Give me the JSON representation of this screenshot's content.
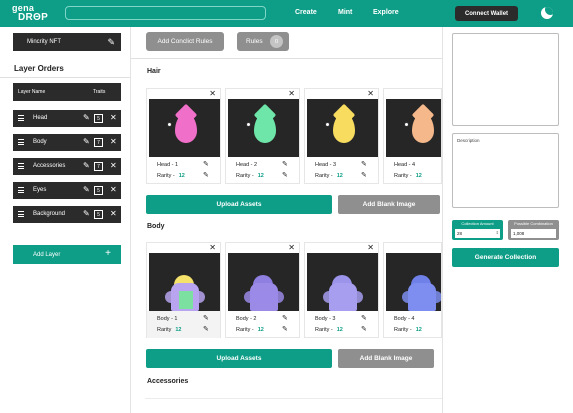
{
  "header": {
    "logo_line1": "gena",
    "logo_line2": "DRΘP",
    "nav": [
      "Create",
      "Mint",
      "Explore"
    ],
    "connect_wallet": "Connect Wallet"
  },
  "sidebar": {
    "collection_name": "Mincrity NFT",
    "layer_orders_title": "Layer Orders",
    "col_layer_name": "Layer Name",
    "col_traits": "Traits",
    "layers": [
      {
        "name": "Head",
        "traits": "5"
      },
      {
        "name": "Body",
        "traits": "7"
      },
      {
        "name": "Accessories",
        "traits": "7"
      },
      {
        "name": "Eyes",
        "traits": "5"
      },
      {
        "name": "Background",
        "traits": "5"
      }
    ],
    "add_layer": "Add Layer"
  },
  "main": {
    "add_rules": "Add Conclict Rules",
    "rules_label": "Rules",
    "rules_count": "0",
    "sections": [
      {
        "title": "Hair",
        "cards": [
          {
            "name": "Head - 1",
            "rarity_label": "Rarity -",
            "rarity": "12",
            "color": "#f06fc9"
          },
          {
            "name": "Head - 2",
            "rarity_label": "Rarity -",
            "rarity": "12",
            "color": "#6fe6a9"
          },
          {
            "name": "Head - 3",
            "rarity_label": "Rarity -",
            "rarity": "12",
            "color": "#f7dc5f"
          },
          {
            "name": "Head - 4",
            "rarity_label": "Rarity -",
            "rarity": "12",
            "color": "#f5b88a"
          }
        ],
        "upload": "Upload Assets",
        "blank": "Add Blank Image"
      },
      {
        "title": "Body",
        "cards": [
          {
            "name": "Body - 1",
            "rarity_label": "Rarity",
            "rarity": "12",
            "color": "#b8a4f0"
          },
          {
            "name": "Body - 2",
            "rarity_label": "Rarity -",
            "rarity": "12",
            "color": "#9b8ae6"
          },
          {
            "name": "Body - 3",
            "rarity_label": "Rarity -",
            "rarity": "12",
            "color": "#a79ef0"
          },
          {
            "name": "Body - 4",
            "rarity_label": "Rarity -",
            "rarity": "12",
            "color": "#7d8ef0"
          }
        ],
        "upload": "Upload Assets",
        "blank": "Add Blank Image"
      }
    ],
    "next_section": "Accessories"
  },
  "right": {
    "description_placeholder": "Description",
    "collection_amount_label": "Collection Amount",
    "collection_amount": "28",
    "possible_combinations_label": "Possible Combination",
    "possible_combinations": "1,008",
    "generate": "Generate Collection"
  }
}
